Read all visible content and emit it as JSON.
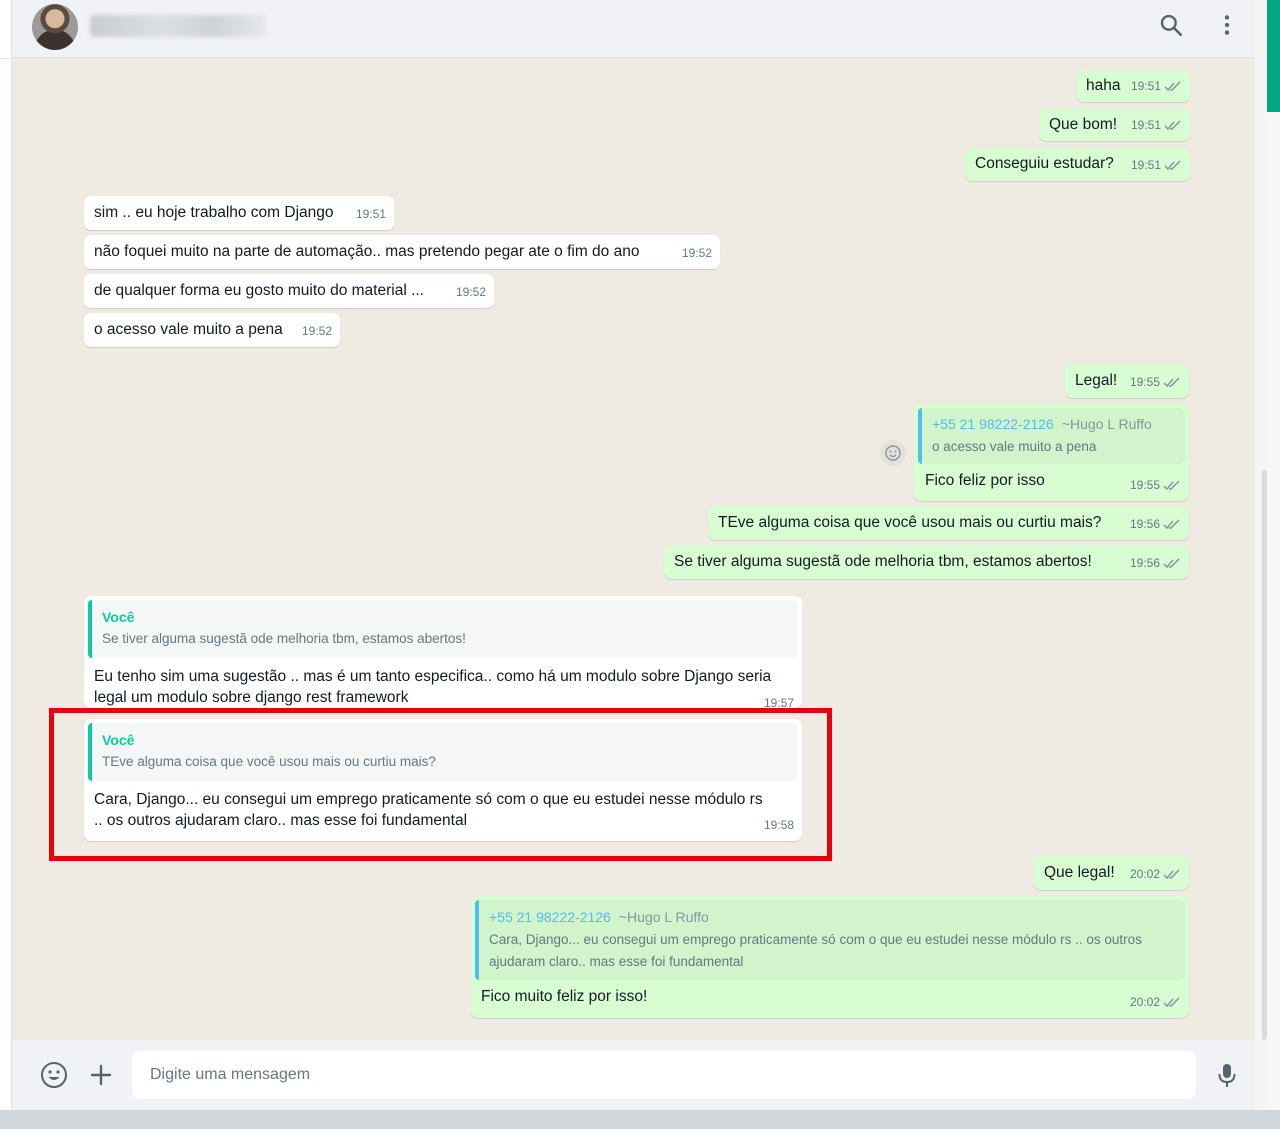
{
  "header": {
    "contact_name": "",
    "icons": [
      "search-icon",
      "menu-icon"
    ]
  },
  "messages": [
    {
      "id": "m1",
      "dir": "out",
      "text": "haha",
      "time": "19:51",
      "status": "read"
    },
    {
      "id": "m2",
      "dir": "out",
      "text": "Que bom!",
      "time": "19:51",
      "status": "read"
    },
    {
      "id": "m3",
      "dir": "out",
      "text": "Conseguiu estudar?",
      "time": "19:51",
      "status": "read"
    },
    {
      "id": "m4",
      "dir": "in",
      "text": "sim .. eu hoje trabalho com Django",
      "time": "19:51"
    },
    {
      "id": "m5",
      "dir": "in",
      "text": "não foquei muito na parte de automação.. mas pretendo pegar ate o fim do ano",
      "time": "19:52"
    },
    {
      "id": "m6",
      "dir": "in",
      "text": "de qualquer forma eu gosto muito do material ...",
      "time": "19:52"
    },
    {
      "id": "m7",
      "dir": "in",
      "text": "o acesso vale muito a pena",
      "time": "19:52"
    },
    {
      "id": "m8",
      "dir": "out",
      "text": "Legal!",
      "time": "19:55",
      "status": "read"
    },
    {
      "id": "m9",
      "dir": "out",
      "quote": {
        "phone": "+55 21 98222-2126",
        "name": "~Hugo L Ruffo",
        "text": "o acesso vale muito a pena"
      },
      "text": "Fico feliz por isso",
      "time": "19:55",
      "status": "read"
    },
    {
      "id": "m10",
      "dir": "out",
      "text": "TEve alguma coisa que você usou mais ou curtiu mais?",
      "time": "19:56",
      "status": "read"
    },
    {
      "id": "m11",
      "dir": "out",
      "text": "Se tiver alguma sugestã ode melhoria tbm, estamos abertos!",
      "time": "19:56",
      "status": "read"
    },
    {
      "id": "m12",
      "dir": "in",
      "quote": {
        "author": "Você",
        "text": "Se tiver alguma sugestã ode melhoria tbm, estamos abertos!"
      },
      "text": "Eu tenho sim uma sugestão .. mas é um tanto especifica.. como há um modulo sobre Django seria legal um modulo sobre django rest framework",
      "time": "19:57"
    },
    {
      "id": "m13",
      "dir": "in",
      "quote": {
        "author": "Você",
        "text": "TEve alguma coisa que você usou mais ou curtiu mais?"
      },
      "text": "Cara, Django... eu consegui um emprego praticamente só com o que eu estudei nesse módulo rs .. os outros ajudaram claro.. mas esse foi fundamental",
      "time": "19:58",
      "highlighted": true
    },
    {
      "id": "m14",
      "dir": "out",
      "text": "Que legal!",
      "time": "20:02",
      "status": "read"
    },
    {
      "id": "m15",
      "dir": "out",
      "quote": {
        "phone": "+55 21 98222-2126",
        "name": "~Hugo L Ruffo",
        "text": "Cara, Django... eu consegui um emprego praticamente só com o que eu estudei nesse módulo rs .. os outros ajudaram claro.. mas esse foi fundamental"
      },
      "text": "Fico muito feliz por isso!",
      "time": "20:02",
      "status": "read"
    }
  ],
  "composer": {
    "placeholder": "Digite uma mensagem",
    "value": ""
  },
  "colors": {
    "outgoing_bubble": "#d9fdd3",
    "incoming_bubble": "#ffffff",
    "chat_background": "#efeae2",
    "accent": "#00a884",
    "quote_author": "#06cf9c",
    "quote_phone": "#53bdeb",
    "read_ticks": "#8696a0",
    "highlight_box": "#e8000b"
  }
}
